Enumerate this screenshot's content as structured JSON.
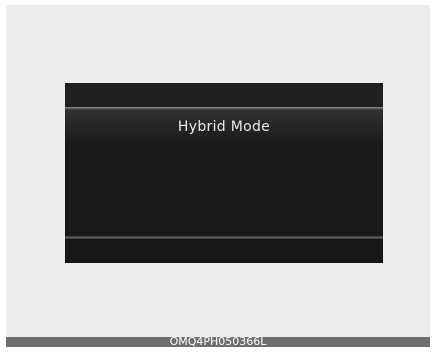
{
  "display": {
    "title": "Hybrid Mode"
  },
  "caption": {
    "code": "OMQ4PH050366L"
  },
  "colors": {
    "background": "#ececec",
    "screen": "#1b1919",
    "screen_text": "#e9e9e9",
    "caption_bar": "#6f6f6f"
  }
}
